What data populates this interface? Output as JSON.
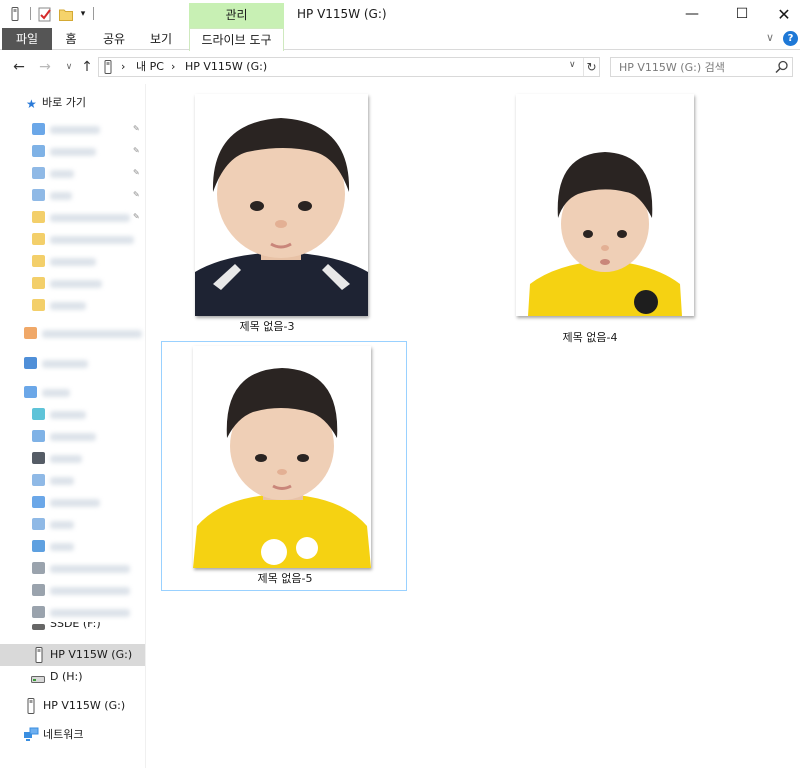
{
  "title_bar": {
    "window_title": "HP V115W (G:)",
    "context_tab_group": "관리",
    "minimize": "—",
    "maximize": "☐",
    "close": "✕"
  },
  "ribbon": {
    "tabs": [
      "파일",
      "홈",
      "공유",
      "보기",
      "드라이브 도구"
    ],
    "active_tab": "드라이브 도구"
  },
  "address_bar": {
    "path": [
      "내 PC",
      "HP V115W (G:)"
    ],
    "separator": "›"
  },
  "search": {
    "placeholder": "HP V115W (G:) 검색"
  },
  "navigation_pane": {
    "quick_access_label": "바로 가기",
    "items": [
      {
        "label": "SSDE (F:)",
        "icon": "drive-icon"
      },
      {
        "label": "HP V115W (G:)",
        "icon": "usb-drive-icon",
        "selected": true
      },
      {
        "label": "D (H:)",
        "icon": "drive-icon"
      },
      {
        "label": "HP V115W (G:)",
        "icon": "usb-drive-icon"
      },
      {
        "label": "네트워크",
        "icon": "network-icon"
      }
    ]
  },
  "files": [
    {
      "name": "제목 없음-3",
      "shirt": "navy"
    },
    {
      "name": "제목 없음-4",
      "shirt": "yellow"
    },
    {
      "name": "제목 없음-5",
      "shirt": "yellow",
      "selected": true
    }
  ],
  "colors": {
    "context_tab": "#c8f0b4",
    "file_tab": "#555555",
    "selection": "#99d1ff",
    "nav_selected": "#d9d9d9"
  }
}
